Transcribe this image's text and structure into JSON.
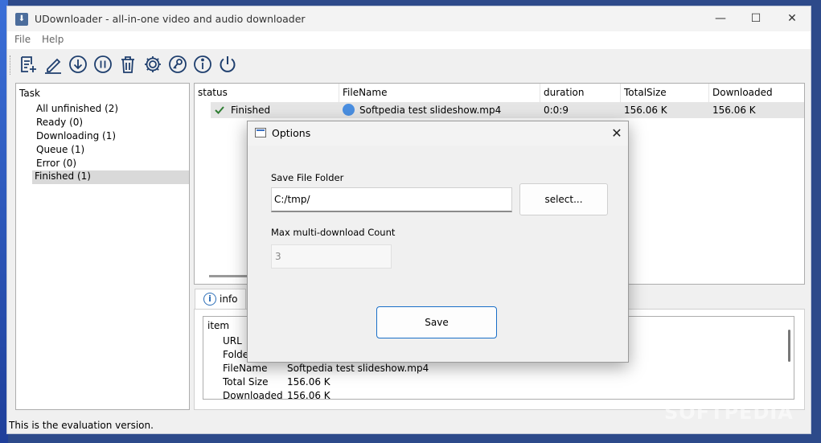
{
  "window": {
    "title": "UDownloader - all-in-one video and audio downloader",
    "min_glyph": "—",
    "max_glyph": "☐",
    "close_glyph": "✕"
  },
  "menu": {
    "items": [
      {
        "label": "File"
      },
      {
        "label": "Help"
      }
    ]
  },
  "toolbar": {
    "buttons": [
      {
        "icon": "add-task-icon"
      },
      {
        "icon": "edit-icon"
      },
      {
        "icon": "download-icon"
      },
      {
        "icon": "pause-icon"
      },
      {
        "icon": "delete-icon"
      },
      {
        "icon": "settings-icon"
      },
      {
        "icon": "key-icon"
      },
      {
        "icon": "info-icon"
      },
      {
        "icon": "power-icon"
      }
    ]
  },
  "tasks": {
    "header": "Task",
    "items": [
      {
        "label": "All unfinished (2)"
      },
      {
        "label": "Ready (0)"
      },
      {
        "label": "Downloading (1)"
      },
      {
        "label": "Queue (1)"
      },
      {
        "label": "Error (0)"
      },
      {
        "label": "Finished (1)",
        "selected": true
      }
    ]
  },
  "list": {
    "columns": [
      "status",
      "FileName",
      "duration",
      "TotalSize",
      "Downloaded"
    ],
    "rows": [
      {
        "status": "Finished",
        "filename": "Softpedia test slideshow.mp4",
        "duration": "0:0:9",
        "total_size": "156.06 K",
        "downloaded": "156.06 K"
      }
    ]
  },
  "info": {
    "tab_label": "info",
    "header": "item",
    "fields": [
      {
        "key": "URL",
        "value": ""
      },
      {
        "key": "Folder",
        "value": ""
      },
      {
        "key": "FileName",
        "value": "Softpedia test slideshow.mp4"
      },
      {
        "key": "Total Size",
        "value": "156.06 K"
      },
      {
        "key": "Downloaded",
        "value": "156.06 K"
      }
    ]
  },
  "status_bar": "This is the evaluation version.",
  "dialog": {
    "title": "Options",
    "close_glyph": "✕",
    "save_folder_label": "Save File Folder",
    "save_folder_value": "C:/tmp/",
    "select_button": "select...",
    "max_count_label": "Max multi-download Count",
    "max_count_value": "3",
    "save_button": "Save"
  },
  "watermark": "SOFTPEDIA",
  "colors": {
    "accent": "#1a6fc8",
    "toolbar_icon": "#1f3f6e",
    "check": "#2e7d32"
  }
}
